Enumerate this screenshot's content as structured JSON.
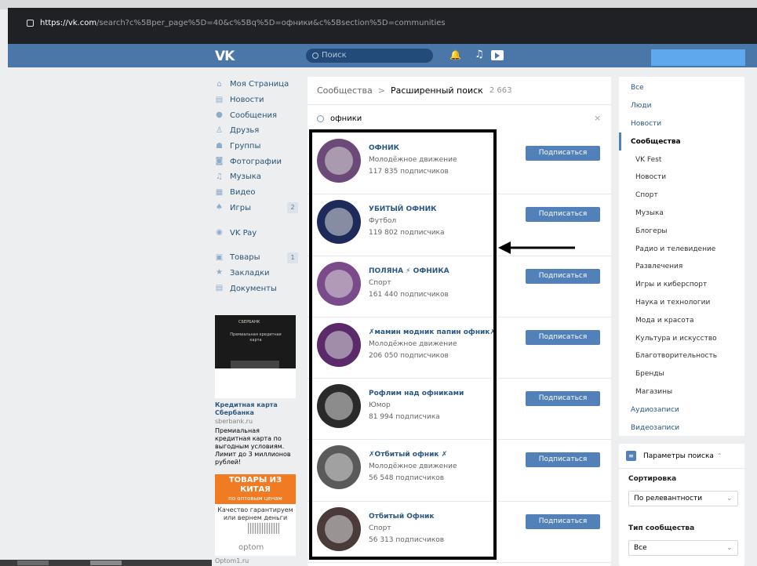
{
  "browser": {
    "url_host": "https://vk.com",
    "url_path": "/search?c%5Bper_page%5D=40&c%5Bq%5D=офники&c%5Bsection%5D=communities"
  },
  "header": {
    "logo": "VK",
    "search_placeholder": "Поиск"
  },
  "sidebar": {
    "items": [
      {
        "label": "Моя Страница",
        "icon": "home-icon"
      },
      {
        "label": "Новости",
        "icon": "news-icon"
      },
      {
        "label": "Сообщения",
        "icon": "messages-icon"
      },
      {
        "label": "Друзья",
        "icon": "friends-icon"
      },
      {
        "label": "Группы",
        "icon": "groups-icon"
      },
      {
        "label": "Фотографии",
        "icon": "camera-icon"
      },
      {
        "label": "Музыка",
        "icon": "music-icon"
      },
      {
        "label": "Видео",
        "icon": "video-icon"
      },
      {
        "label": "Игры",
        "icon": "games-icon",
        "count": "2"
      },
      {
        "label": "VK Pay",
        "icon": "pay-icon"
      },
      {
        "label": "Товары",
        "icon": "goods-icon",
        "count": "1"
      },
      {
        "label": "Закладки",
        "icon": "star-icon"
      },
      {
        "label": "Документы",
        "icon": "documents-icon"
      }
    ]
  },
  "ads": {
    "ad1": {
      "brand": "СБЕРБАНК",
      "image_text": "Премиальная кредитная карта",
      "title": "Кредитная карта Сбербанка",
      "domain": "sberbank.ru",
      "text": "Премиальная кредитная карта по выгодным условиям. Лимит до 3 миллионов рублей!"
    },
    "ad2": {
      "header": "ТОВАРЫ ИЗ КИТАЯ",
      "subheader": "по оптовым ценам",
      "text": "Качество гарантируем или вернем деньги",
      "logo": "optom",
      "domain": "Optom1.ru"
    }
  },
  "main": {
    "breadcrumb_a": "Сообщества",
    "breadcrumb_sep": ">",
    "breadcrumb_b": "Расширенный поиск",
    "count": "2 663",
    "query": "офники",
    "clear": "×",
    "subscribe_label": "Подписаться",
    "results": [
      {
        "name": "ОФНИК",
        "category": "Молодёжное движение",
        "subscribers": "117 835 подписчиков",
        "color": "#6b4a7a"
      },
      {
        "name": "УБИТЫЙ ОФНИК",
        "category": "Футбол",
        "subscribers": "119 802 подписчика",
        "color": "#1e2a5a"
      },
      {
        "name": "ПОЛЯНА ⚡ ОФНИКА",
        "category": "Спорт",
        "subscribers": "161 440 подписчиков",
        "color": "#7a4a8a"
      },
      {
        "name": "✗мамин модник папин офник✗",
        "category": "Молодёжное движение",
        "subscribers": "206 050 подписчиков",
        "color": "#5a2a6a"
      },
      {
        "name": "Рофлим над офниками",
        "category": "Юмор",
        "subscribers": "81 994 подписчика",
        "color": "#2a2a2a"
      },
      {
        "name": "✗Отбитый офник ✗",
        "category": "Молодёжное движение",
        "subscribers": "56 548 подписчиков",
        "color": "#5a5a5a"
      },
      {
        "name": "Отбитый Офник",
        "category": "Спорт",
        "subscribers": "56 313 подписчиков",
        "color": "#4a3a3a"
      }
    ]
  },
  "right_nav": {
    "items": [
      {
        "label": "Все",
        "level": "top"
      },
      {
        "label": "Люди",
        "level": "top"
      },
      {
        "label": "Новости",
        "level": "top"
      },
      {
        "label": "Сообщества",
        "level": "top",
        "active": true
      },
      {
        "label": "VK Fest",
        "level": "sub"
      },
      {
        "label": "Новости",
        "level": "sub"
      },
      {
        "label": "Спорт",
        "level": "sub"
      },
      {
        "label": "Музыка",
        "level": "sub"
      },
      {
        "label": "Блогеры",
        "level": "sub"
      },
      {
        "label": "Радио и телевидение",
        "level": "sub"
      },
      {
        "label": "Развлечения",
        "level": "sub"
      },
      {
        "label": "Игры и киберспорт",
        "level": "sub"
      },
      {
        "label": "Наука и технологии",
        "level": "sub"
      },
      {
        "label": "Мода и красота",
        "level": "sub"
      },
      {
        "label": "Культура и искусство",
        "level": "sub"
      },
      {
        "label": "Благотворительность",
        "level": "sub"
      },
      {
        "label": "Бренды",
        "level": "sub"
      },
      {
        "label": "Магазины",
        "level": "sub"
      },
      {
        "label": "Аудиозаписи",
        "level": "top"
      },
      {
        "label": "Видеозаписи",
        "level": "top"
      }
    ]
  },
  "params": {
    "title": "Параметры поиска",
    "chevron": "⌃",
    "sort_label": "Сортировка",
    "sort_value": "По релевантности",
    "type_label": "Тип сообщества",
    "type_value": "Все"
  },
  "colors": {
    "header": "#4a76a8",
    "button": "#5181b8",
    "link": "#2a5885"
  }
}
